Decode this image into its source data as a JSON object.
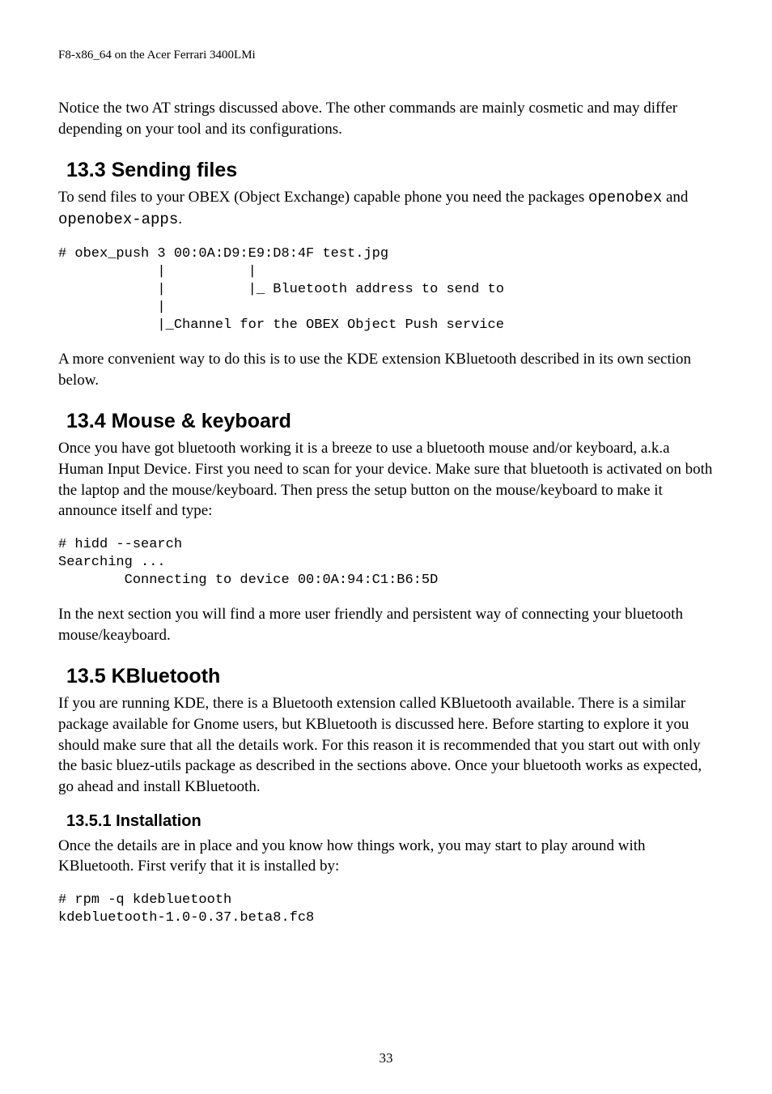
{
  "header": {
    "running": "F8-x86_64 on the Acer Ferrari 3400LMi"
  },
  "intro_para": "Notice the two AT strings discussed above. The other commands are mainly cosmetic and may differ depending on your tool and its configurations.",
  "s133": {
    "title": "13.3 Sending files",
    "para_pre": "To send files to your OBEX (Object Exchange) capable phone you need the packages ",
    "pkg1": "openobex",
    "para_mid": " and ",
    "pkg2": "openobex-apps",
    "para_post": ".",
    "code": "# obex_push 3 00:0A:D9:E9:D8:4F test.jpg\n            |          |\n            |          |_ Bluetooth address to send to\n            |\n            |_Channel for the OBEX Object Push service",
    "after": "A more convenient way to do this is to use the KDE extension KBluetooth described in its own section below."
  },
  "s134": {
    "title": "13.4 Mouse & keyboard",
    "para": "Once you have got bluetooth working it is a breeze to use a bluetooth mouse and/or keyboard, a.k.a Human Input Device. First you need to scan for your device. Make sure that bluetooth is activated on both the laptop and the mouse/keyboard. Then press the setup button on the mouse/keyboard to make it announce itself and type:",
    "code": "# hidd --search\nSearching ...\n        Connecting to device 00:0A:94:C1:B6:5D",
    "after": "In the next section you will find a more user friendly and persistent way of connecting your bluetooth mouse/keayboard."
  },
  "s135": {
    "title": "13.5 KBluetooth",
    "para": "If you are running KDE, there is a Bluetooth extension called KBluetooth available. There is a similar package available for Gnome users, but KBluetooth is discussed here. Before starting to explore it you should make sure that all the details work. For this reason it is recommended that you start out with only the basic bluez-utils package as described in the sections above. Once your bluetooth works as expected, go ahead and install KBluetooth."
  },
  "s1351": {
    "title": "13.5.1 Installation",
    "para": "Once the details are in place and you know how things work, you may start to play around with KBluetooth. First verify that it is installed by:",
    "code": "# rpm -q kdebluetooth\nkdebluetooth-1.0-0.37.beta8.fc8"
  },
  "page_number": "33"
}
